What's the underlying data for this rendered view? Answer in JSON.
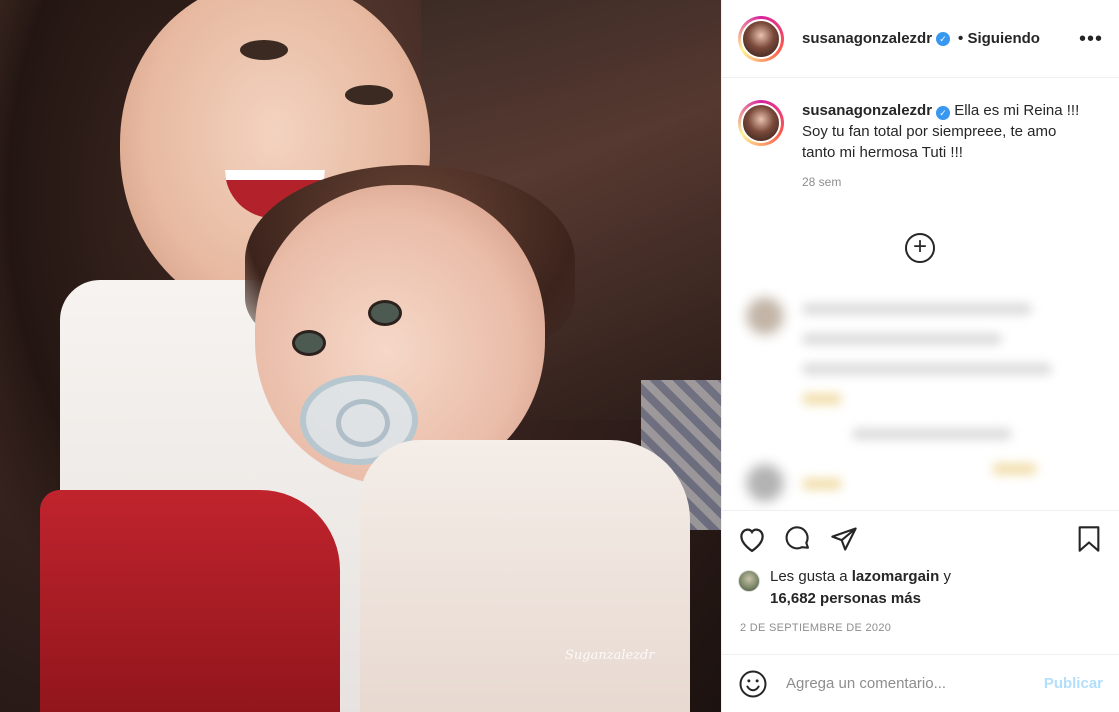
{
  "post": {
    "username": "susanagonzalezdr",
    "follow_status": "• Siguiendo",
    "more_label": "•••",
    "caption": "Ella es mi Reina !!! Soy tu fan total por siempreee, te amo tanto mi hermosa Tuti !!!",
    "caption_time": "28 sem",
    "load_more_label": "+",
    "photo_watermark": "Suganzalezdr"
  },
  "likes": {
    "prefix": "Les gusta a",
    "liker": "lazomargain",
    "middle": "y",
    "count_text": "16,682 personas más"
  },
  "date": "2 DE SEPTIEMBRE DE 2020",
  "comment": {
    "placeholder": "Agrega un comentario...",
    "publish_label": "Publicar"
  },
  "icons": {
    "like": "heart-icon",
    "comment": "comment-icon",
    "share": "share-icon",
    "save": "bookmark-icon",
    "emoji": "smile-icon",
    "verified": "verified-badge-icon"
  },
  "colors": {
    "verified": "#3897f0",
    "publish_disabled": "#b2dffc",
    "muted_text": "#8e8e8e"
  }
}
